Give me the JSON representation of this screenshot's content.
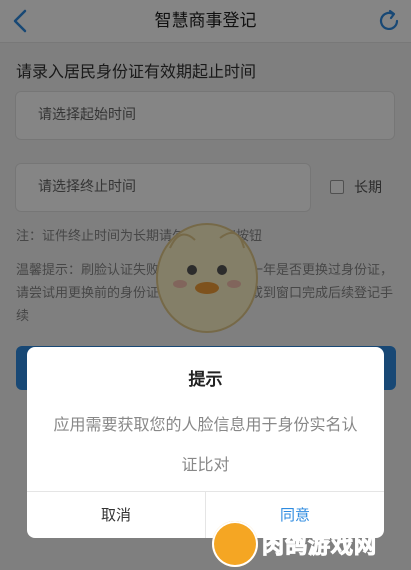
{
  "nav": {
    "title": "智慧商事登记",
    "back_icon": "chevron-left-icon",
    "refresh_icon": "refresh-icon"
  },
  "form": {
    "section_title": "请录入居民身份证有效期起止时间",
    "start_placeholder": "请选择起始时间",
    "end_placeholder": "请选择终止时间",
    "longterm_label": "长期",
    "note": "注：证件终止时间为长期请勾选\"长期\"按钮",
    "tip": "温馨提示：刷脸认证失败？请您核确认近一年是否更换过身份证，请尝试用更换前的身份证有效期重试认证或到窗口完成后续登记手续"
  },
  "dialog": {
    "title": "提示",
    "message": "应用需要获取您的人脸信息用于身份实名认证比对",
    "cancel_label": "取消",
    "agree_label": "同意"
  },
  "watermark": {
    "text": "肉鸽游戏网"
  },
  "colors": {
    "accent": "#2e8be0",
    "overlay": "rgba(0,0,0,0.48)",
    "watermark": "#f5a623"
  }
}
